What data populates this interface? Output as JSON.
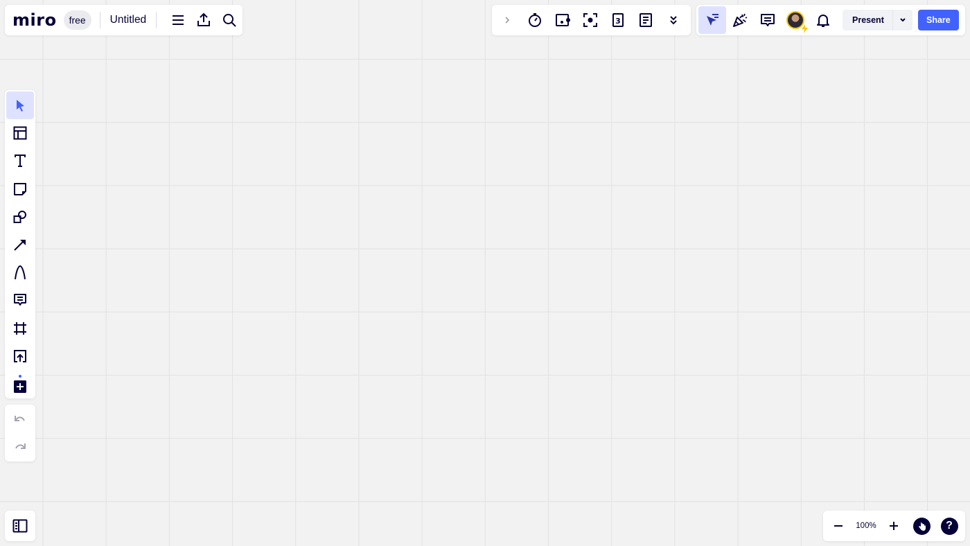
{
  "board": {
    "logo": "miro",
    "plan_badge": "free",
    "title": "Untitled",
    "icons": [
      "menu-icon",
      "export-icon",
      "search-icon"
    ]
  },
  "collab_toolbar": {
    "icons": [
      "chevron-right-icon",
      "timer-icon",
      "activity-icon",
      "focus-icon",
      "voting-icon",
      "notes-icon",
      "double-chevron-down-icon"
    ]
  },
  "top_right": {
    "icons": [
      "follow-cursor-icon",
      "reactions-icon",
      "comments-icon",
      "avatar",
      "bell-icon"
    ],
    "present_label": "Present",
    "share_label": "Share"
  },
  "left_toolbar": {
    "tools": [
      "select",
      "templates",
      "text",
      "sticky-note",
      "shapes",
      "connection-line",
      "pen",
      "comment",
      "frame",
      "upload",
      "more-apps"
    ],
    "active_tool": "select"
  },
  "history": {
    "undo_enabled": false,
    "redo_enabled": false
  },
  "zoom": {
    "level": "100%"
  },
  "colors": {
    "accent": "#4262ff",
    "active_bg": "#dfe2ff",
    "ink": "#050038",
    "canvas": "#f2f2f2",
    "avatar_ring": "#fac710"
  }
}
